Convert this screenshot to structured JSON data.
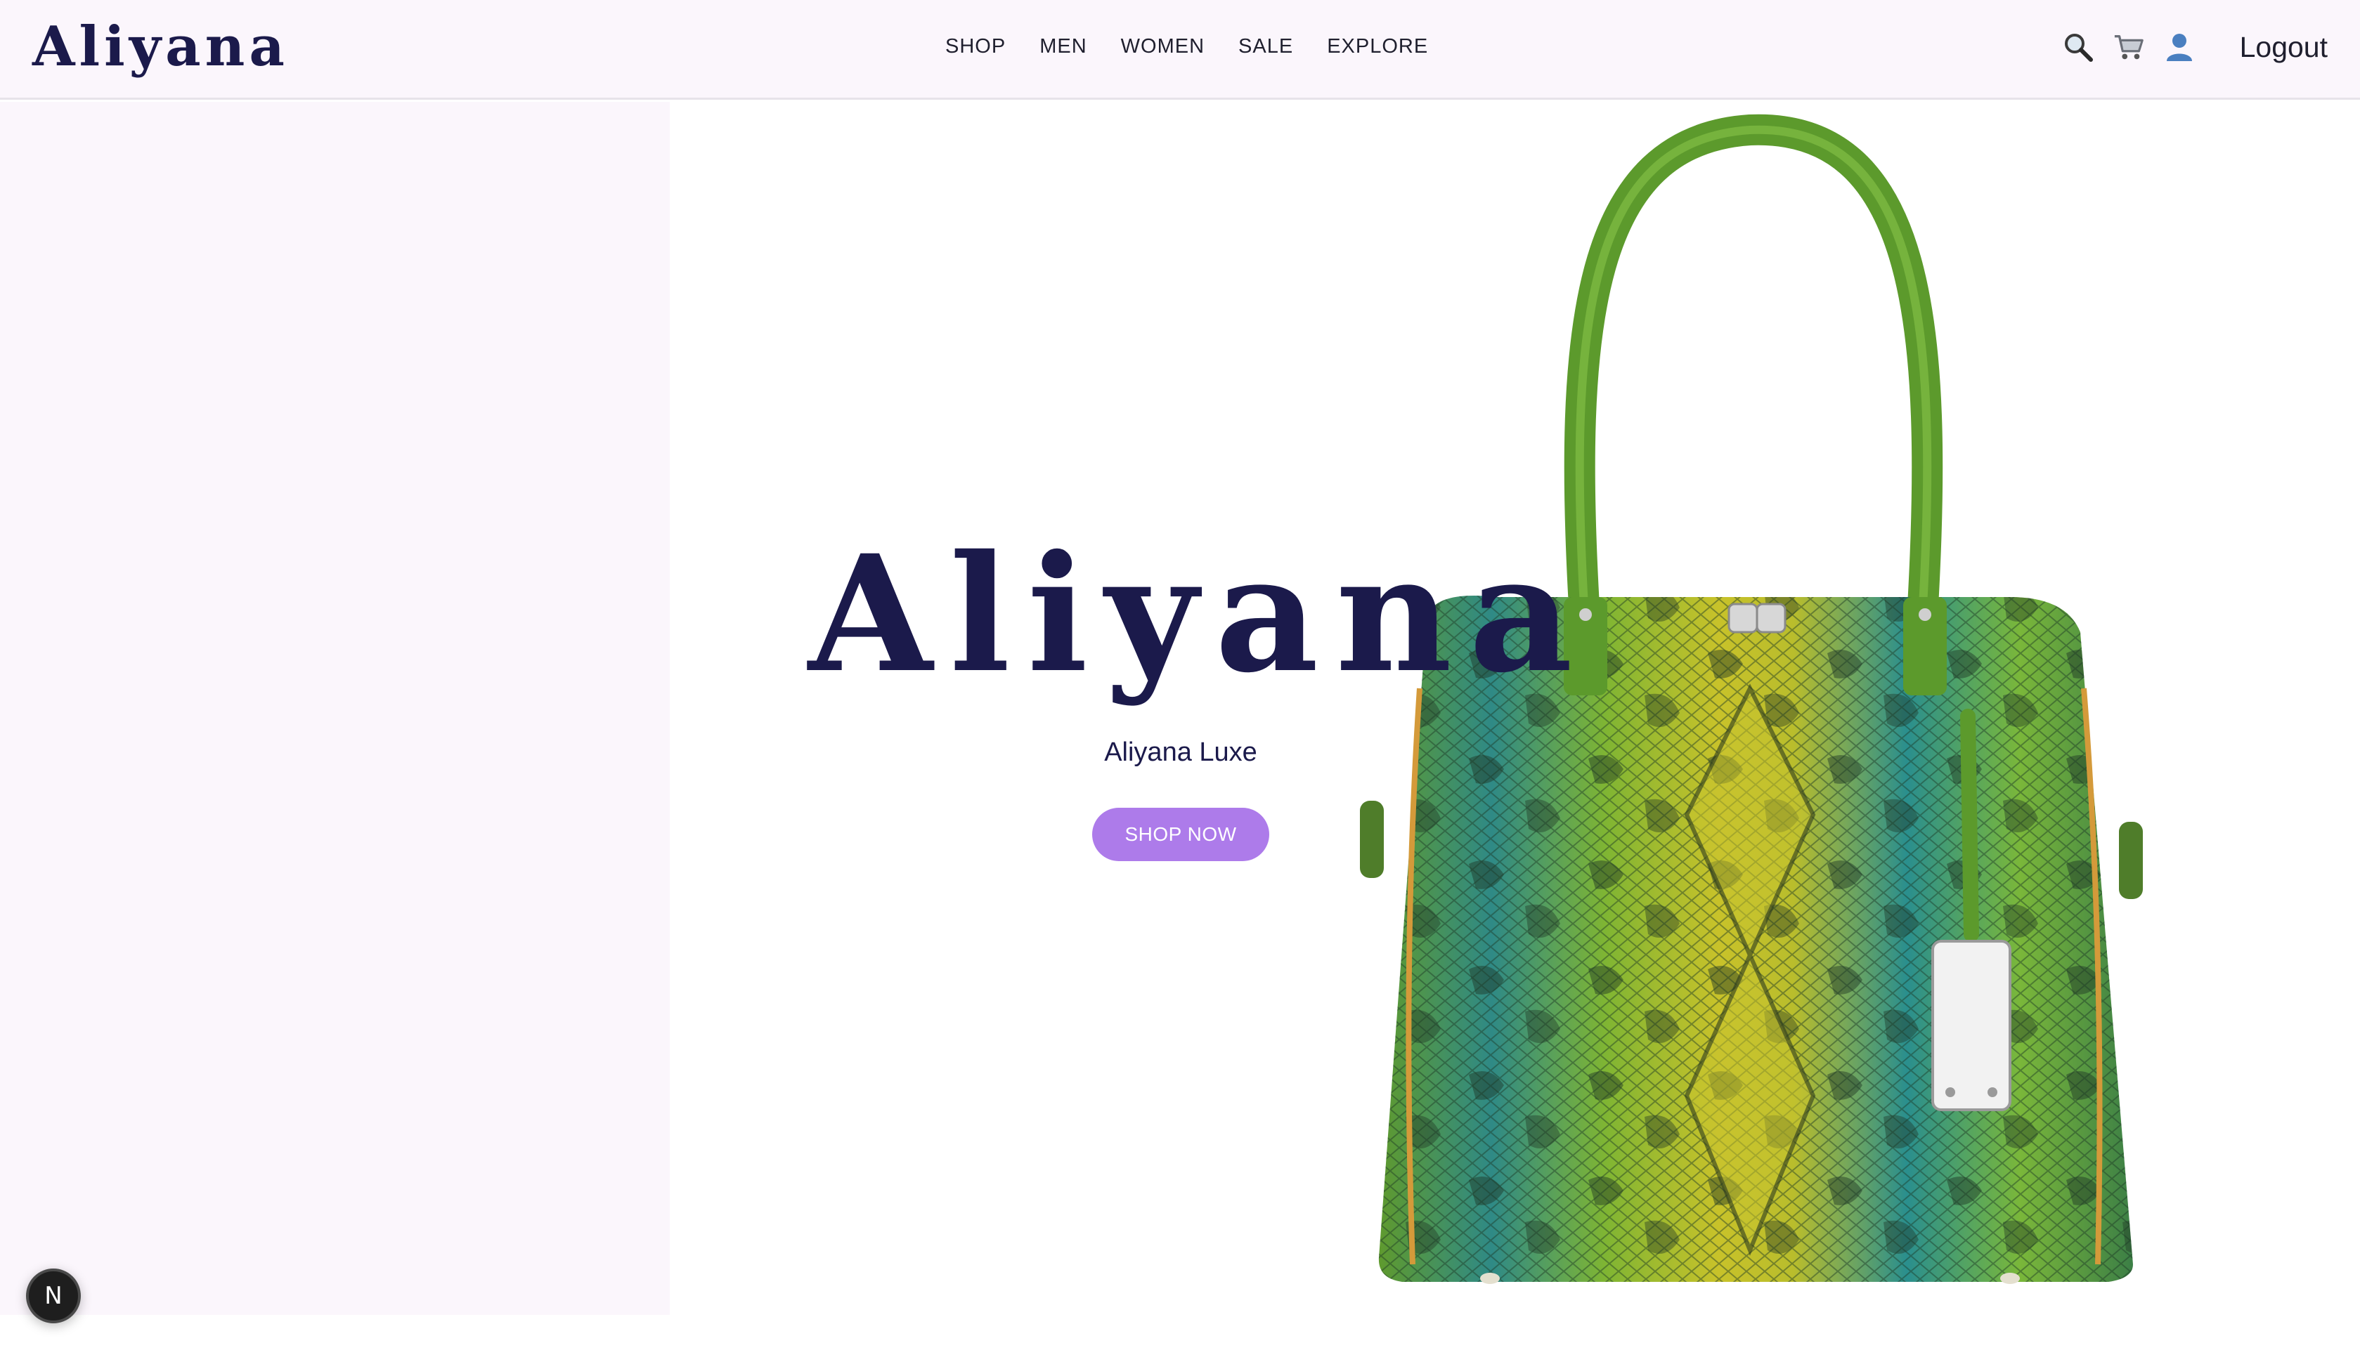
{
  "header": {
    "brand": "Aliyana",
    "nav": [
      "SHOP",
      "MEN",
      "WOMEN",
      "SALE",
      "EXPLORE"
    ],
    "icons": [
      "search-icon",
      "cart-icon",
      "user-icon"
    ],
    "logout_label": "Logout"
  },
  "hero": {
    "title": "Aliyana",
    "subtitle": "Aliyana Luxe",
    "cta_label": "SHOP NOW",
    "product_image": "green-snakeskin-handbag"
  },
  "dev_badge": {
    "label": "N"
  },
  "colors": {
    "header_bg": "#fbf6fc",
    "brand_navy": "#1b1a4b",
    "cta_purple": "#ad7bea",
    "panel_bg": "#fbf6fc"
  }
}
